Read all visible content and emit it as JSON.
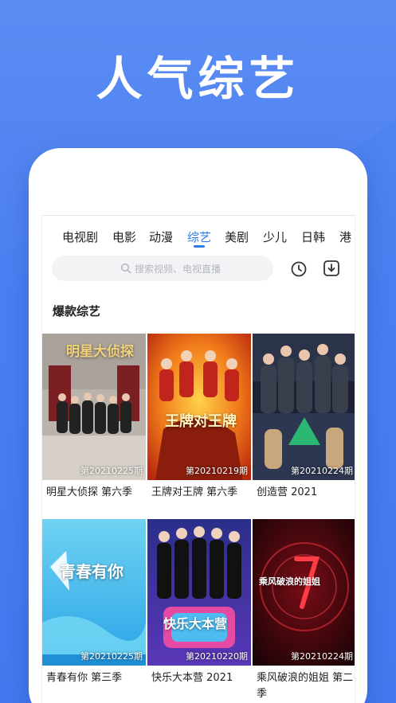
{
  "headline": "人气综艺",
  "tabs": [
    {
      "label": "电视剧"
    },
    {
      "label": "电影"
    },
    {
      "label": "动漫"
    },
    {
      "label": "综艺"
    },
    {
      "label": "美剧"
    },
    {
      "label": "少儿"
    },
    {
      "label": "日韩"
    },
    {
      "label": "港"
    }
  ],
  "active_tab": "综艺",
  "search": {
    "placeholder": "搜索视频、电视直播"
  },
  "section_title": "爆款综艺",
  "cards": [
    {
      "title": "明星大侦探 第六季",
      "episode": "第20210225期",
      "poster_text": "明星大侦探"
    },
    {
      "title": "王牌对王牌 第六季",
      "episode": "第20210219期",
      "poster_text": "王牌对王牌"
    },
    {
      "title": "创造营 2021",
      "episode": "第20210224期",
      "poster_text": ""
    },
    {
      "title": "青春有你 第三季",
      "episode": "第20210225期",
      "poster_text": "青春有你"
    },
    {
      "title": "快乐大本营 2021",
      "episode": "第20210220期",
      "poster_text": "快乐大本营"
    },
    {
      "title": "乘风破浪的姐姐 第二季",
      "episode": "第20210224期",
      "poster_text": "乘风破浪的姐姐"
    }
  ],
  "colors": {
    "accent": "#2b7bf0",
    "background": "#4a7ef0"
  }
}
